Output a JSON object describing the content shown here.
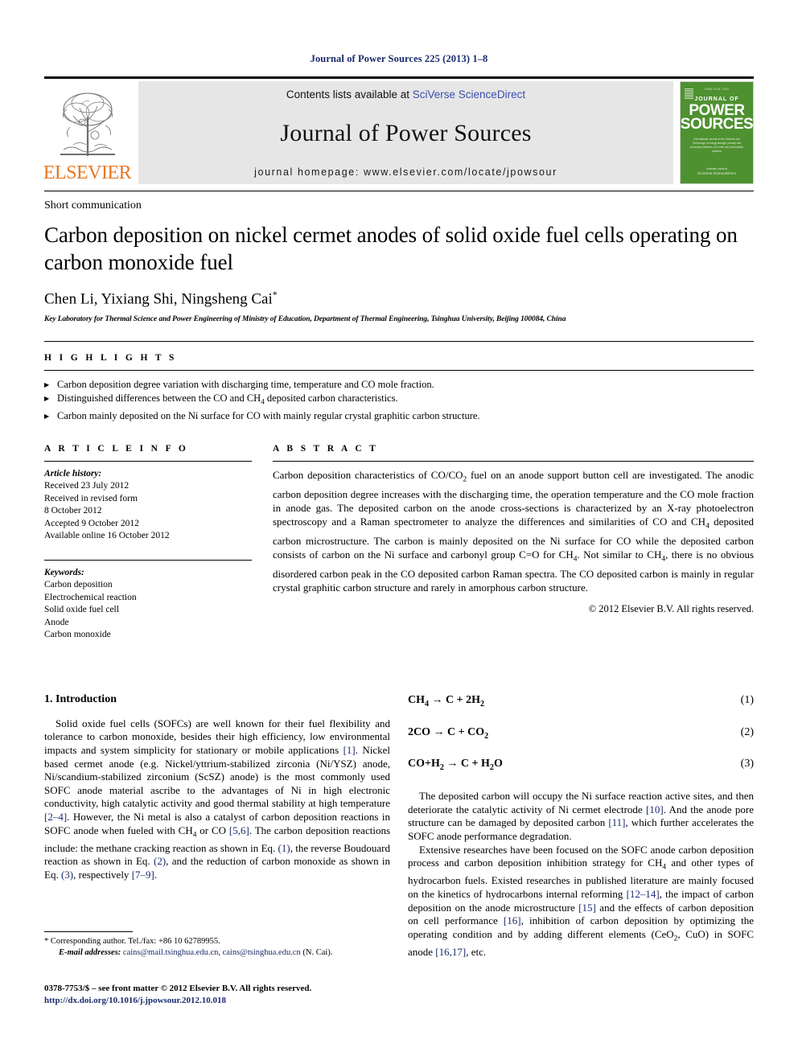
{
  "running_head": "Journal of Power Sources 225 (2013) 1–8",
  "masthead": {
    "publisher_logo_text": "ELSEVIER",
    "contents_prefix": "Contents lists available at ",
    "contents_link": "SciVerse ScienceDirect",
    "journal_name": "Journal of Power Sources",
    "homepage_line": "journal homepage: www.elsevier.com/locate/jpowsour",
    "cover": {
      "top_line": "ISSN 0378-7753",
      "line1": "JOURNAL OF",
      "line2": "POWER",
      "line3": "SOURCES",
      "subtitle": "International Journal on the Science and Technology of energy storage, primary and secondary batteries, fuel cells and photovoltaic systems",
      "footer_small": "Available online at",
      "footer_big": "SciVerse ScienceDirect"
    },
    "link_color": "#3b4fb0",
    "band_color": "#e6e6e6",
    "cover_color": "#4e9130",
    "elsevier_orange": "#E87722"
  },
  "article": {
    "doctype": "Short communication",
    "title": "Carbon deposition on nickel cermet anodes of solid oxide fuel cells operating on carbon monoxide fuel",
    "authors": "Chen Li, Yixiang Shi, Ningsheng Cai",
    "author_marker": "*",
    "affiliation": "Key Laboratory for Thermal Science and Power Engineering of Ministry of Education, Department of Thermal Engineering, Tsinghua University, Beijing 100084, China"
  },
  "highlights": {
    "label": "H I G H L I G H T S",
    "items": [
      "Carbon deposition degree variation with discharging time, temperature and CO mole fraction.",
      "Distinguished differences between the CO and CH4 deposited carbon characteristics.",
      "Carbon mainly deposited on the Ni surface for CO with mainly regular crystal graphitic carbon structure."
    ]
  },
  "article_info": {
    "label": "A R T I C L E  I N F O",
    "history_label": "Article history:",
    "history": [
      "Received 23 July 2012",
      "Received in revised form",
      "8 October 2012",
      "Accepted 9 October 2012",
      "Available online 16 October 2012"
    ],
    "keywords_label": "Keywords:",
    "keywords": [
      "Carbon deposition",
      "Electrochemical reaction",
      "Solid oxide fuel cell",
      "Anode",
      "Carbon monoxide"
    ]
  },
  "abstract": {
    "label": "A B S T R A C T",
    "text": "Carbon deposition characteristics of CO/CO2 fuel on an anode support button cell are investigated. The anodic carbon deposition degree increases with the discharging time, the operation temperature and the CO mole fraction in anode gas. The deposited carbon on the anode cross-sections is characterized by an X-ray photoelectron spectroscopy and a Raman spectrometer to analyze the differences and similarities of CO and CH4 deposited carbon microstructure. The carbon is mainly deposited on the Ni surface for CO while the deposited carbon consists of carbon on the Ni surface and carbonyl group C=O for CH4. Not similar to CH4, there is no obvious disordered carbon peak in the CO deposited carbon Raman spectra. The CO deposited carbon is mainly in regular crystal graphitic carbon structure and rarely in amorphous carbon structure.",
    "copyright": "© 2012 Elsevier B.V. All rights reserved."
  },
  "body": {
    "section_heading": "1.  Introduction",
    "left_paragraph_1": "Solid oxide fuel cells (SOFCs) are well known for their fuel flexibility and tolerance to carbon monoxide, besides their high efficiency, low environmental impacts and system simplicity for stationary or mobile applications [1]. Nickel based cermet anode (e.g. Nickel/yttrium-stabilized zirconia (Ni/YSZ) anode, Ni/scandium-stabilized zirconium (ScSZ) anode) is the most commonly used SOFC anode material ascribe to the advantages of Ni in high electronic conductivity, high catalytic activity and good thermal stability at high temperature [2–4]. However, the Ni metal is also a catalyst of carbon deposition reactions in SOFC anode when fueled with CH4 or CO [5,6]. The carbon deposition reactions include: the methane cracking reaction as shown in Eq. (1), the reverse Boudouard reaction as shown in Eq. (2), and the reduction of carbon monoxide as shown in Eq. (3), respectively [7–9].",
    "equations": [
      {
        "formula": "CH4 → C + 2H2",
        "number": "(1)"
      },
      {
        "formula": "2CO → C + CO2",
        "number": "(2)"
      },
      {
        "formula": "CO+H2 → C + H2O",
        "number": "(3)"
      }
    ],
    "right_paragraph_1": "The deposited carbon will occupy the Ni surface reaction active sites, and then deteriorate the catalytic activity of Ni cermet electrode [10]. And the anode pore structure can be damaged by deposited carbon [11], which further accelerates the SOFC anode performance degradation.",
    "right_paragraph_2": "Extensive researches have been focused on the SOFC anode carbon deposition process and carbon deposition inhibition strategy for CH4 and other types of hydrocarbon fuels. Existed researches in published literature are mainly focused on the kinetics of hydrocarbons internal reforming [12–14], the impact of carbon deposition on the anode microstructure [15] and the effects of carbon deposition on cell performance [16], inhibition of carbon deposition by optimizing the operating condition and by adding different elements (CeO2, CuO) in SOFC anode [16,17], etc."
  },
  "footnotes": {
    "corresponding": "* Corresponding author. Tel./fax: +86 10 62789955.",
    "email_label": "E-mail addresses:",
    "email_1": "cains@mail.tsinghua.edu.cn",
    "email_2": "cains@tsinghua.edu.cn",
    "email_suffix": "(N. Cai).",
    "imprint_line": "0378-7753/$ – see front matter © 2012 Elsevier B.V. All rights reserved.",
    "doi_line": "http://dx.doi.org/10.1016/j.jpowsour.2012.10.018"
  }
}
